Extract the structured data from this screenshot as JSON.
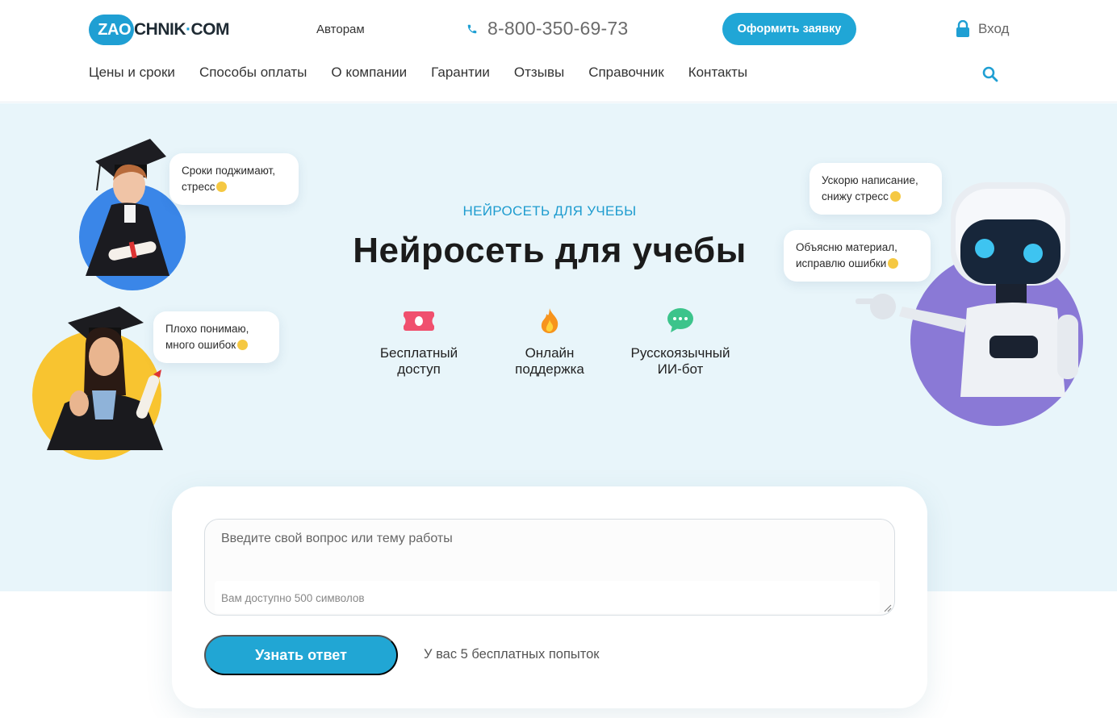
{
  "header": {
    "logo": {
      "badge": "ZAO",
      "rest": "CHNIK",
      "dot": "·",
      "suffix": "COM"
    },
    "authors_link": "Авторам",
    "phone": "8-800-350-69-73",
    "order_button": "Оформить заявку",
    "login": "Вход",
    "nav": [
      "Цены и сроки",
      "Способы оплаты",
      "О компании",
      "Гарантии",
      "Отзывы",
      "Справочник",
      "Контакты"
    ]
  },
  "hero": {
    "kicker": "НЕЙРОСЕТЬ ДЛЯ УЧЕБЫ",
    "title": "Нейросеть для учебы",
    "features": [
      {
        "line1": "Бесплатный",
        "line2": "доступ",
        "icon": "ticket-icon"
      },
      {
        "line1": "Онлайн",
        "line2": "поддержка",
        "icon": "flame-icon"
      },
      {
        "line1": "Русскоязычный",
        "line2": "ИИ-бот",
        "icon": "chat-icon"
      }
    ],
    "bubbles": {
      "student1": {
        "line1": "Сроки поджимают,",
        "line2": "стресс"
      },
      "student2": {
        "line1": "Плохо понимаю,",
        "line2": "много ошибок"
      },
      "robot1": {
        "line1": "Ускорю написание,",
        "line2": "снижу стресс"
      },
      "robot2": {
        "line1": "Объясню материал,",
        "line2": "исправлю ошибки"
      }
    }
  },
  "form": {
    "placeholder": "Введите свой вопрос или тему работы",
    "char_hint": "Вам доступно 500 символов",
    "submit_label": "Узнать ответ",
    "attempts": "У вас 5 бесплатных попыток"
  },
  "colors": {
    "accent": "#20a6d6",
    "hero_bg": "#e8f5fa",
    "blue_circle": "#3a86e8",
    "yellow_circle": "#f8c430",
    "purple_circle": "#8a79d6"
  }
}
